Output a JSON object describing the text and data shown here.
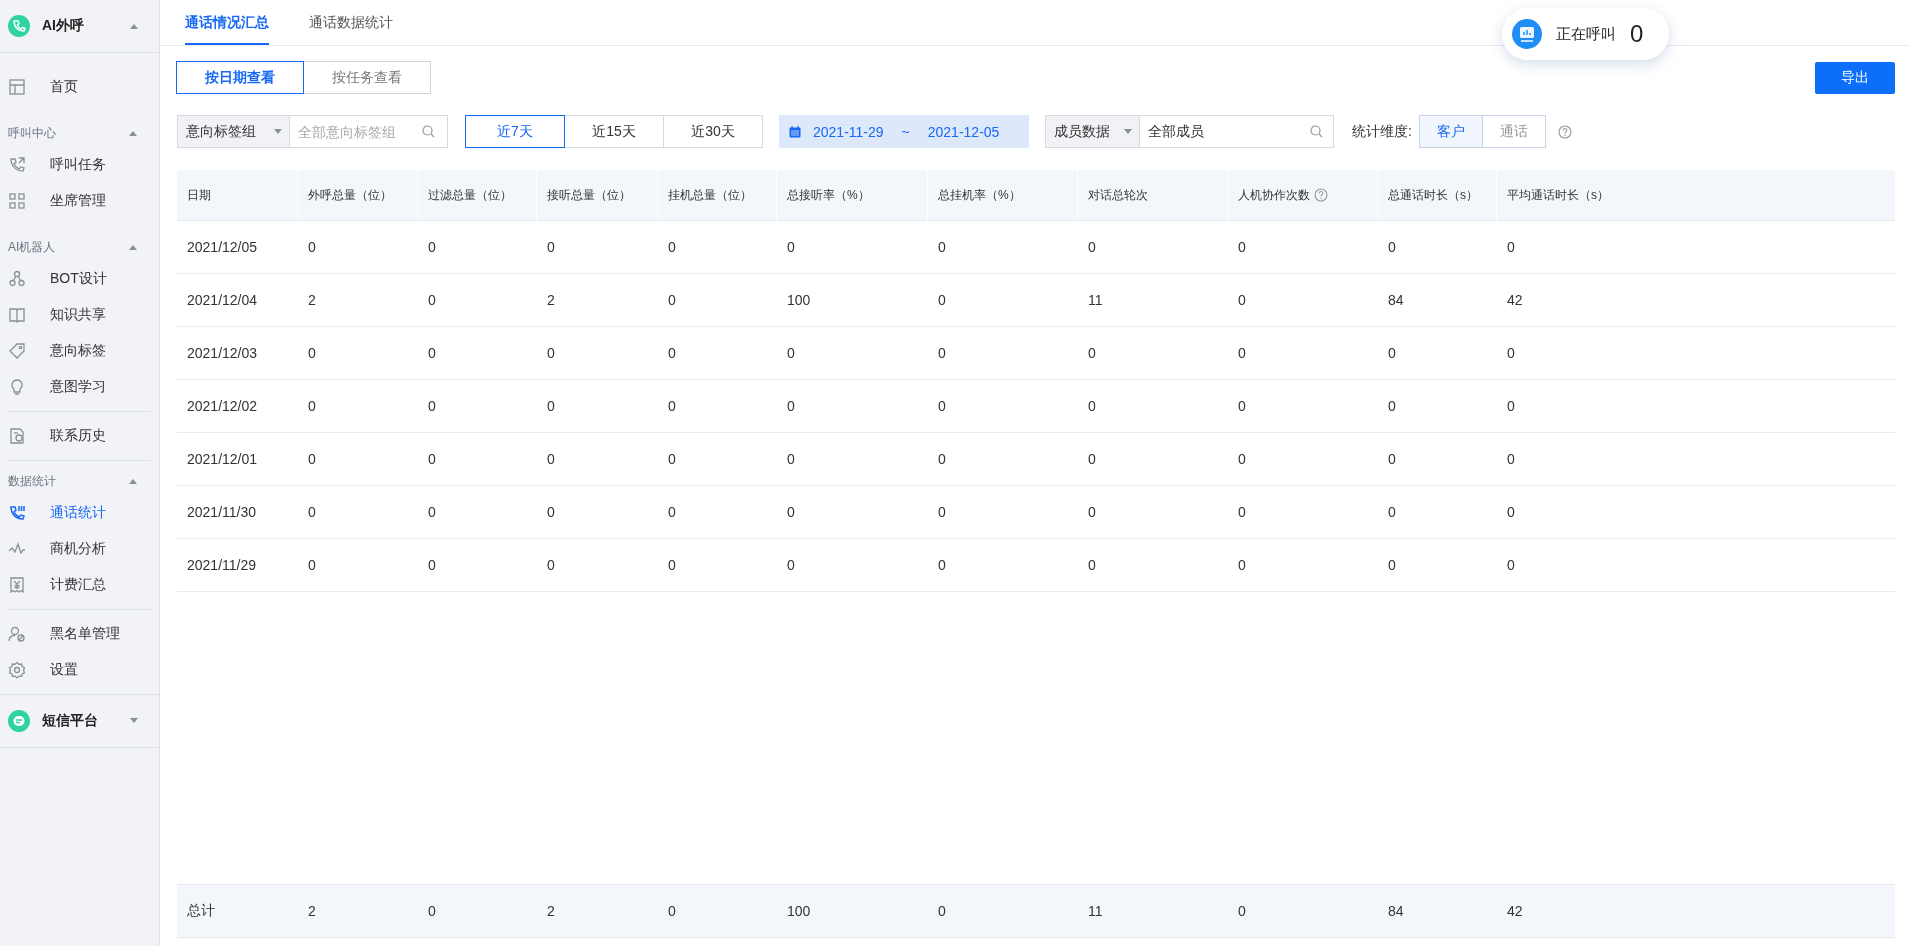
{
  "sidebar": {
    "brand": {
      "title": "AI外呼",
      "expanded": true
    },
    "groups": [
      {
        "divider_above": false,
        "items": [
          {
            "label": "首页",
            "selected": false
          }
        ]
      },
      {
        "divider_above": false,
        "title": "呼叫中心",
        "expanded": true,
        "items": [
          {
            "label": "呼叫任务",
            "selected": false
          },
          {
            "label": "坐席管理",
            "selected": false
          }
        ]
      },
      {
        "divider_above": false,
        "title": "AI机器人",
        "expanded": true,
        "items": [
          {
            "label": "BOT设计",
            "selected": false
          },
          {
            "label": "知识共享",
            "selected": false
          },
          {
            "label": "意向标签",
            "selected": false
          },
          {
            "label": "意图学习",
            "selected": false
          }
        ]
      },
      {
        "divider_above": true,
        "items": [
          {
            "label": "联系历史",
            "selected": false
          }
        ]
      },
      {
        "divider_above": true,
        "title": "数据统计",
        "expanded": true,
        "items": [
          {
            "label": "通话统计",
            "selected": true
          },
          {
            "label": "商机分析",
            "selected": false
          },
          {
            "label": "计费汇总",
            "selected": false
          }
        ]
      },
      {
        "divider_above": true,
        "items": [
          {
            "label": "黑名单管理",
            "selected": false
          },
          {
            "label": "设置",
            "selected": false
          }
        ]
      }
    ],
    "footer_brand": {
      "title": "短信平台",
      "expanded": false
    }
  },
  "tabs": [
    {
      "label": "通话情况汇总",
      "selected": true
    },
    {
      "label": "通话数据统计",
      "selected": false
    }
  ],
  "calling_badge": {
    "label": "正在呼叫",
    "count": "0"
  },
  "view_modes": [
    {
      "label": "按日期查看",
      "selected": true
    },
    {
      "label": "按任务查看",
      "selected": false
    }
  ],
  "export_button": "导出",
  "filters": {
    "tag_group": {
      "type": "意向标签组",
      "placeholder": "全部意向标签组"
    },
    "ranges": [
      {
        "label": "近7天",
        "selected": true
      },
      {
        "label": "近15天",
        "selected": false
      },
      {
        "label": "近30天",
        "selected": false
      }
    ],
    "date_range": {
      "start": "2021-11-29",
      "separator": "~",
      "end": "2021-12-05"
    },
    "member": {
      "type": "成员数据",
      "value": "全部成员"
    },
    "dimension": {
      "label": "统计维度:",
      "options": [
        {
          "label": "客户",
          "selected": true
        },
        {
          "label": "通话",
          "selected": false
        }
      ]
    }
  },
  "table": {
    "columns": [
      {
        "label": "日期",
        "help": false
      },
      {
        "label": "外呼总量（位）",
        "help": false
      },
      {
        "label": "过滤总量（位）",
        "help": false
      },
      {
        "label": "接听总量（位）",
        "help": false
      },
      {
        "label": "挂机总量（位）",
        "help": false
      },
      {
        "label": "总接听率（%）",
        "help": false
      },
      {
        "label": "总挂机率（%）",
        "help": false
      },
      {
        "label": "对话总轮次",
        "help": false
      },
      {
        "label": "人机协作次数",
        "help": true
      },
      {
        "label": "总通话时长（s）",
        "help": false
      },
      {
        "label": "平均通话时长（s）",
        "help": false
      }
    ],
    "rows": [
      [
        "2021/12/05",
        "0",
        "0",
        "0",
        "0",
        "0",
        "0",
        "0",
        "0",
        "0",
        "0"
      ],
      [
        "2021/12/04",
        "2",
        "0",
        "2",
        "0",
        "100",
        "0",
        "11",
        "0",
        "84",
        "42"
      ],
      [
        "2021/12/03",
        "0",
        "0",
        "0",
        "0",
        "0",
        "0",
        "0",
        "0",
        "0",
        "0"
      ],
      [
        "2021/12/02",
        "0",
        "0",
        "0",
        "0",
        "0",
        "0",
        "0",
        "0",
        "0",
        "0"
      ],
      [
        "2021/12/01",
        "0",
        "0",
        "0",
        "0",
        "0",
        "0",
        "0",
        "0",
        "0",
        "0"
      ],
      [
        "2021/11/30",
        "0",
        "0",
        "0",
        "0",
        "0",
        "0",
        "0",
        "0",
        "0",
        "0"
      ],
      [
        "2021/11/29",
        "0",
        "0",
        "0",
        "0",
        "0",
        "0",
        "0",
        "0",
        "0",
        "0"
      ]
    ],
    "total": [
      "总计",
      "2",
      "0",
      "2",
      "0",
      "100",
      "0",
      "11",
      "0",
      "84",
      "42"
    ]
  }
}
